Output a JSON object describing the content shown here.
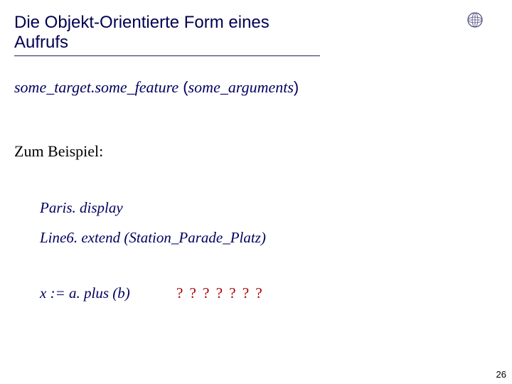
{
  "title": "Die Objekt-Orientierte Form eines Aufrufs",
  "syntax": {
    "target": "some_target",
    "dot": ".",
    "feature": "some_feature",
    "open": " (",
    "args": "some_arguments",
    "close": ")"
  },
  "example_label": "Zum Beispiel:",
  "examples": {
    "ex1": "Paris. display",
    "ex2": "Line6. extend (Station_Parade_Platz)",
    "ex3": "x := a. plus (b)",
    "question": "? ? ? ? ? ? ?"
  },
  "page_number": "26",
  "logo_name": "globe-icon"
}
